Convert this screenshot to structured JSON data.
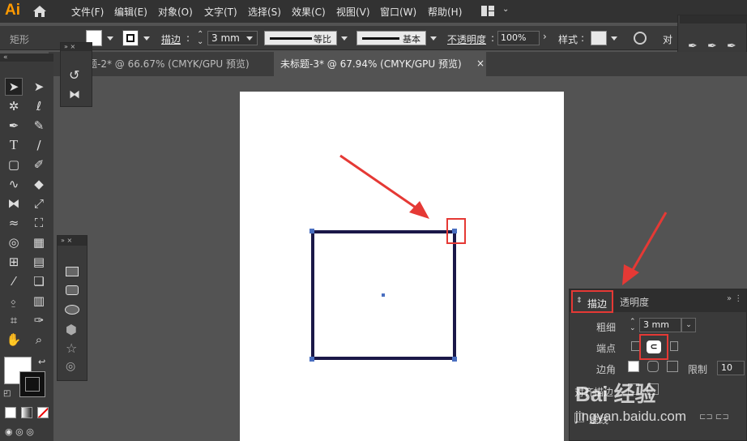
{
  "app": {
    "logo": "Ai"
  },
  "menu": [
    "文件(F)",
    "编辑(E)",
    "对象(O)",
    "文字(T)",
    "选择(S)",
    "效果(C)",
    "视图(V)",
    "窗口(W)",
    "帮助(H)"
  ],
  "control_bar": {
    "object_label": "矩形",
    "stroke_label": "描边",
    "stroke_weight": "3 mm",
    "profile_label": "等比",
    "brush_label": "基本",
    "opacity_label": "不透明度",
    "opacity_value": "100%",
    "style_label": "样式",
    "align_label": "对"
  },
  "tabs": [
    {
      "label": "题-2* @ 66.67% (CMYK/GPU 预览)",
      "active": false
    },
    {
      "label": "未标题-3* @ 67.94% (CMYK/GPU 预览)",
      "active": true
    }
  ],
  "stroke_panel": {
    "tab_stroke": "描边",
    "tab_transparency": "透明度",
    "weight_label": "粗细",
    "weight_value": "3 mm",
    "cap_label": "端点",
    "corner_label": "边角",
    "limit_label": "限制",
    "limit_value": "10",
    "align_label": "对齐描边",
    "dash_label": "虚线"
  },
  "watermark": {
    "text": "Bai 经验",
    "url": "jingyan.baidu.com"
  },
  "colors": {
    "accent_red": "#e53935",
    "shape_stroke": "#1b1848",
    "handle": "#4a6fc0"
  }
}
